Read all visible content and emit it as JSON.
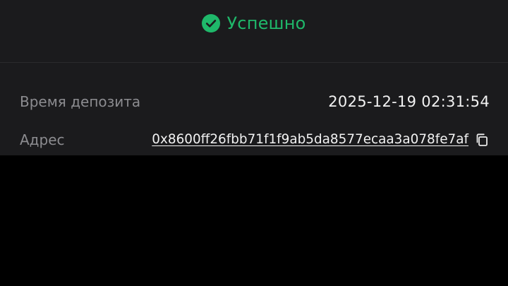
{
  "status": {
    "icon": "check-circle-icon",
    "text": "Успешно",
    "color": "#1fb86a"
  },
  "details": {
    "deposit_time": {
      "label": "Время депозита",
      "value": "2025-12-19 02:31:54"
    },
    "address": {
      "label": "Адрес",
      "value": "0x8600ff26fbb71f1f9ab5da8577ecaa3a078fe7af",
      "copy_icon": "copy-icon"
    }
  },
  "colors": {
    "background_panel": "#1b1b1d",
    "background_page": "#000000",
    "label": "#8c8c90",
    "value": "#f2f2f2",
    "accent": "#1fb86a"
  }
}
